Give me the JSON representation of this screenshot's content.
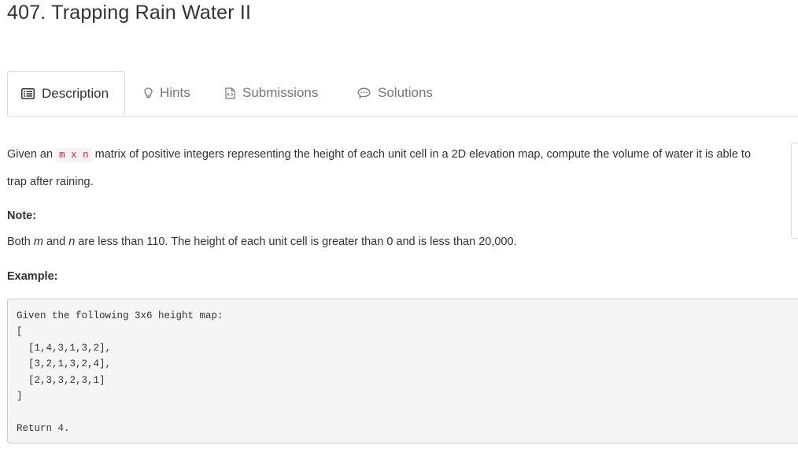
{
  "problem": {
    "title": "407. Trapping Rain Water II"
  },
  "tabs": [
    {
      "label": "Description",
      "icon": "list-alt-icon",
      "active": true
    },
    {
      "label": "Hints",
      "icon": "lightbulb-icon",
      "active": false
    },
    {
      "label": "Submissions",
      "icon": "file-code-icon",
      "active": false
    },
    {
      "label": "Solutions",
      "icon": "comment-icon",
      "active": false
    }
  ],
  "description": {
    "text_before": "Given an ",
    "code": "m x n",
    "text_after": " matrix of positive integers representing the height of each unit cell in a 2D elevation map, compute the volume of water it is able to",
    "text_line2": "trap after raining.",
    "note_heading": "Note:",
    "note_both": "Both ",
    "note_m": "m",
    "note_and": " and ",
    "note_n": "n",
    "note_rest": " are less than 110. The height of each unit cell is greater than 0 and is less than 20,000.",
    "example_heading": "Example:",
    "example_code": "Given the following 3x6 height map:\n[\n  [1,4,3,1,3,2],\n  [3,2,1,3,2,4],\n  [2,3,3,2,3,1]\n]\n\nReturn 4."
  },
  "colors": {
    "accent_code": "#c7254e",
    "border": "#dddddd",
    "pre_bg": "#f5f5f5"
  }
}
